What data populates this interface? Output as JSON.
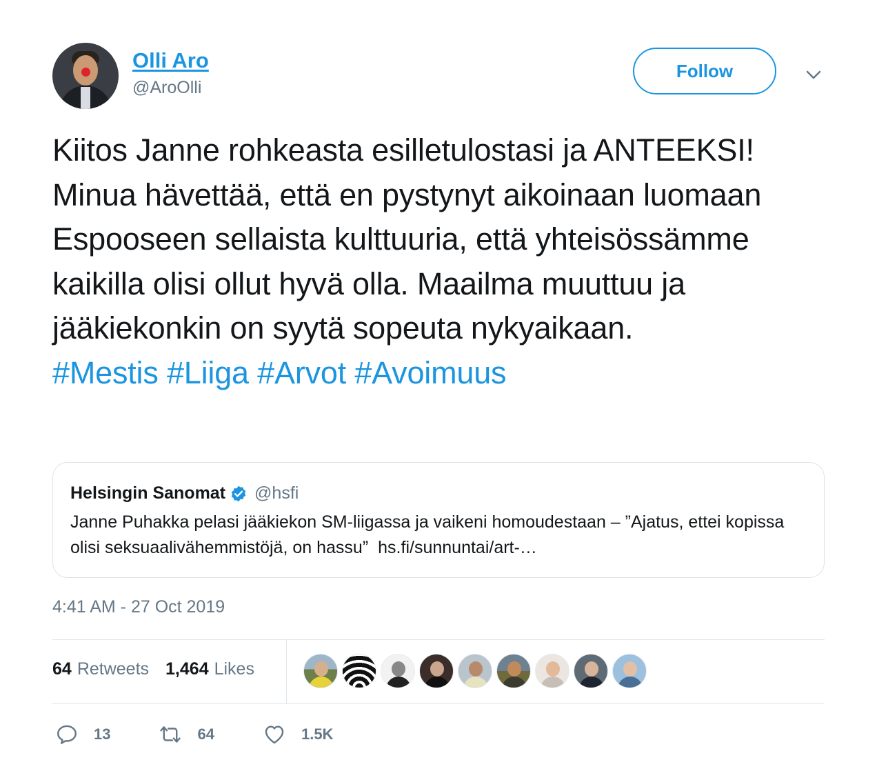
{
  "author": {
    "name": "Olli Aro",
    "handle": "@AroOlli"
  },
  "follow_label": "Follow",
  "tweet": {
    "text": "Kiitos Janne rohkeasta esilletulostasi ja ANTEEKSI! Minua hävettää, että en pystynyt aikoinaan luomaan Espooseen sellaista kulttuuria, että yhteisössämme kaikilla olisi ollut hyvä olla. Maailma muuttuu ja jääkiekonkin on syytä sopeuta nykyaikaan.",
    "hashtags": [
      "#Mestis",
      "#Liiga",
      "#Arvot",
      "#Avoimuus"
    ]
  },
  "quoted": {
    "name": "Helsingin Sanomat",
    "handle": "@hsfi",
    "text": "Janne Puhakka pelasi jääkiekon SM-liigassa ja vaikeni homoudestaan – ”Ajatus, ettei kopissa olisi seksuaalivähemmistöjä, on hassu”",
    "link": "hs.fi/sunnuntai/art-…"
  },
  "timestamp": "4:41 AM - 27 Oct 2019",
  "stats": {
    "retweets_count": "64",
    "retweets_label": "Retweets",
    "likes_count": "1,464",
    "likes_label": "Likes"
  },
  "actions": {
    "reply_count": "13",
    "retweet_count": "64",
    "like_count": "1.5K"
  },
  "colors": {
    "accent": "#1b95e0",
    "text": "#14171a",
    "muted": "#657786",
    "border": "#e1e8ed"
  },
  "icons": [
    "chevron-down-icon",
    "verified-badge-icon",
    "reply-icon",
    "retweet-icon",
    "heart-icon"
  ]
}
